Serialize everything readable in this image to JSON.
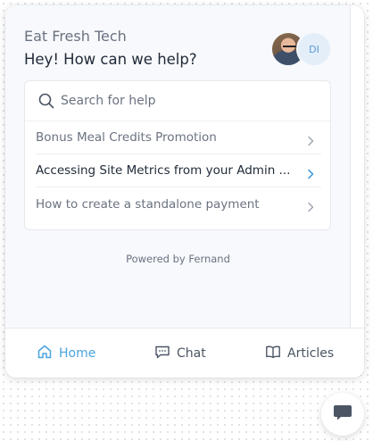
{
  "header": {
    "company_name": "Eat Fresh Tech",
    "greeting": "Hey! How can we help?",
    "avatars": [
      {
        "type": "photo",
        "label": ""
      },
      {
        "type": "initials",
        "label": "DI"
      }
    ]
  },
  "search": {
    "placeholder": "Search for help",
    "value": ""
  },
  "articles": [
    {
      "label": "Bonus Meal Credits Promotion",
      "active": false
    },
    {
      "label": "Accessing Site Metrics from your Admin ...",
      "active": true
    },
    {
      "label": "How to create a standalone payment",
      "active": false
    }
  ],
  "footer": {
    "powered_by": "Powered by Fernand"
  },
  "nav": {
    "home_label": "Home",
    "chat_label": "Chat",
    "articles_label": "Articles",
    "active_tab": "Home"
  },
  "colors": {
    "accent": "#4aa3df",
    "panel_bg": "#f7f9fc",
    "text_primary": "#1f2937",
    "text_secondary": "#6b7280",
    "launcher_icon": "#4b5563"
  },
  "icons": {
    "search": "search-icon",
    "chevron": "chevron-right-icon",
    "home": "home-icon",
    "chat": "chat-bubble-icon",
    "articles": "book-open-icon",
    "launcher": "message-icon"
  }
}
